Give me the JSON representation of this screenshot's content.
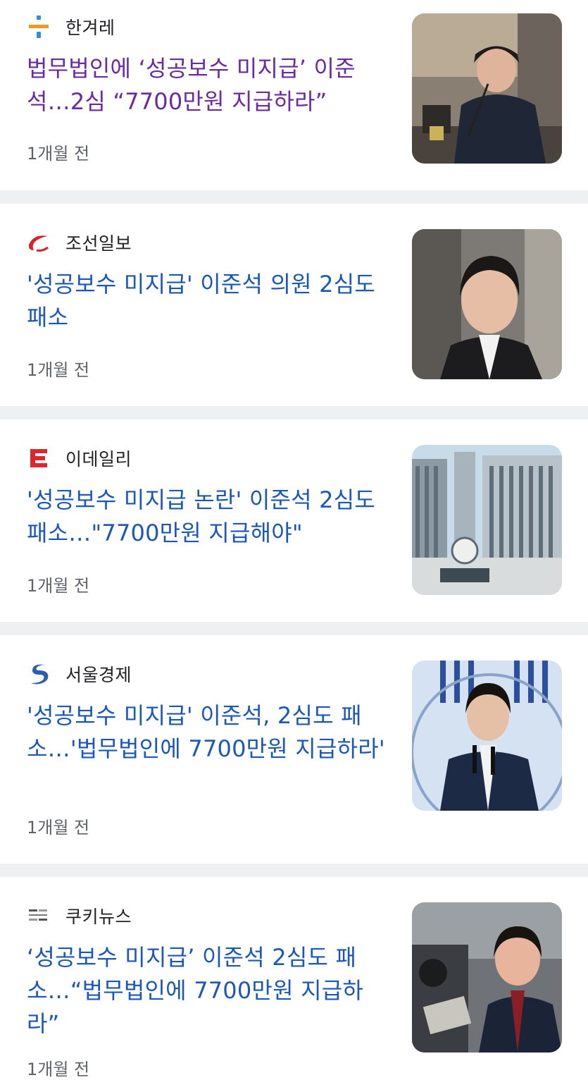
{
  "articles": [
    {
      "source": "한겨레",
      "headline": "법무법인에 ‘성공보수 미지급’ 이준석…2심 “7700만원 지급하라”",
      "time": "1개월 전",
      "visited": true,
      "logo_icon": "hani-logo-icon",
      "thumb": "photo-man-at-microphone-desk"
    },
    {
      "source": "조선일보",
      "headline": "'성공보수 미지급' 이준석 의원 2심도 패소",
      "time": "1개월 전",
      "visited": false,
      "logo_icon": "chosun-logo-icon",
      "thumb": "photo-man-smiling-portrait"
    },
    {
      "source": "이데일리",
      "headline": "'성공보수 미지급 논란' 이준석 2심도 패소…\"7700만원 지급해야\"",
      "time": "1개월 전",
      "visited": false,
      "logo_icon": "edaily-logo-icon",
      "thumb": "photo-court-building"
    },
    {
      "source": "서울경제",
      "headline": "'성공보수 미지급' 이준석, 2심도 패소…'법무법인에 7700만원 지급하라'",
      "time": "1개월 전",
      "visited": false,
      "logo_icon": "sedaily-logo-icon",
      "thumb": "photo-man-at-press-podium"
    },
    {
      "source": "쿠키뉴스",
      "headline": "‘성공보수 미지급’ 이준석 2심도 패소…“법무법인에 7700만원 지급하라”",
      "time": "1개월 전",
      "visited": false,
      "logo_icon": "kukinews-logo-icon",
      "thumb": "photo-man-with-reporters"
    }
  ],
  "colors": {
    "headline": "#1a57b8",
    "headline_visited": "#6a2aa2",
    "source": "#202124",
    "time": "#5f6368",
    "divider": "#eef0f2"
  }
}
